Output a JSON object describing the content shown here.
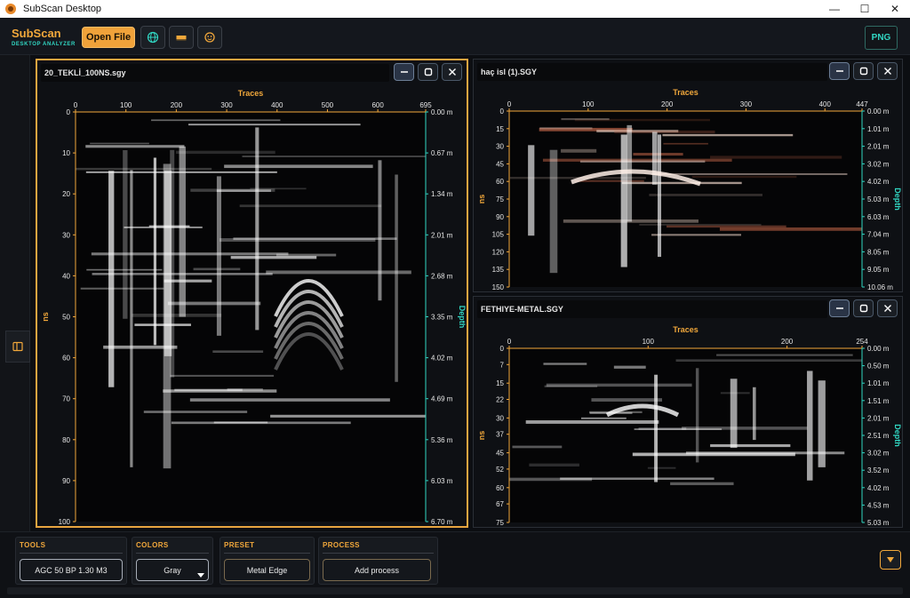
{
  "window": {
    "title": "SubScan Desktop",
    "minimize": "—",
    "maximize": "☐",
    "close": "✕"
  },
  "brand": {
    "name": "SubScan",
    "subtitle": "DESKTOP ANALYZER"
  },
  "toolbar": {
    "open_file": "Open File",
    "tools": [
      {
        "icon": "globe-icon"
      },
      {
        "icon": "ruler-icon"
      },
      {
        "icon": "palette-icon"
      }
    ],
    "png": "PNG"
  },
  "colors": {
    "accent": "#f2a83b",
    "teal": "#31d7c3",
    "panel_border_active": "#e8a540"
  },
  "panels": [
    {
      "title": "20_TEKLİ_100NS.sgy",
      "active": true,
      "x_label": "Traces",
      "y_label": "ns",
      "depth_label": "Depth",
      "x_ticks": [
        "0",
        "100",
        "200",
        "300",
        "400",
        "500",
        "600",
        "695"
      ],
      "x_max": 695,
      "y_ticks": [
        "0",
        "10",
        "20",
        "30",
        "40",
        "50",
        "60",
        "70",
        "80",
        "90",
        "100"
      ],
      "y_max": 100,
      "depth_ticks": [
        "0.00 m",
        "0.67 m",
        "1.34 m",
        "2.01 m",
        "2.68 m",
        "3.35 m",
        "4.02 m",
        "4.69 m",
        "5.36 m",
        "6.03 m",
        "6.70 m"
      ],
      "colormap": "gray"
    },
    {
      "title": "haç isl (1).SGY",
      "active": false,
      "x_label": "Traces",
      "y_label": "ns",
      "depth_label": "Depth",
      "x_ticks": [
        "0",
        "100",
        "200",
        "300",
        "400",
        "447"
      ],
      "x_max": 447,
      "y_ticks": [
        "0",
        "15",
        "30",
        "45",
        "60",
        "75",
        "90",
        "105",
        "120",
        "135",
        "150"
      ],
      "y_max": 150,
      "depth_ticks": [
        "0.00 m",
        "1.01 m",
        "2.01 m",
        "3.02 m",
        "4.02 m",
        "5.03 m",
        "6.03 m",
        "7.04 m",
        "8.05 m",
        "9.05 m",
        "10.06 m"
      ],
      "colormap": "copper"
    },
    {
      "title": "FETHIYE-METAL.SGY",
      "active": false,
      "x_label": "Traces",
      "y_label": "ns",
      "depth_label": "Depth",
      "x_ticks": [
        "0",
        "100",
        "200",
        "254"
      ],
      "x_max": 254,
      "y_ticks": [
        "0",
        "7",
        "15",
        "22",
        "30",
        "37",
        "45",
        "52",
        "60",
        "67",
        "75"
      ],
      "y_max": 75,
      "depth_ticks": [
        "0.00 m",
        "0.50 m",
        "1.01 m",
        "1.51 m",
        "2.01 m",
        "2.51 m",
        "3.02 m",
        "3.52 m",
        "4.02 m",
        "4.53 m",
        "5.03 m"
      ],
      "colormap": "gray"
    }
  ],
  "bottom": {
    "tools": {
      "label": "TOOLS",
      "value": "AGC 50  BP 1.30  M3"
    },
    "colors": {
      "label": "COLORS",
      "value": "Gray"
    },
    "preset": {
      "label": "PRESET",
      "value": "Metal Edge"
    },
    "process": {
      "label": "PROCESS",
      "value": "Add process"
    }
  }
}
